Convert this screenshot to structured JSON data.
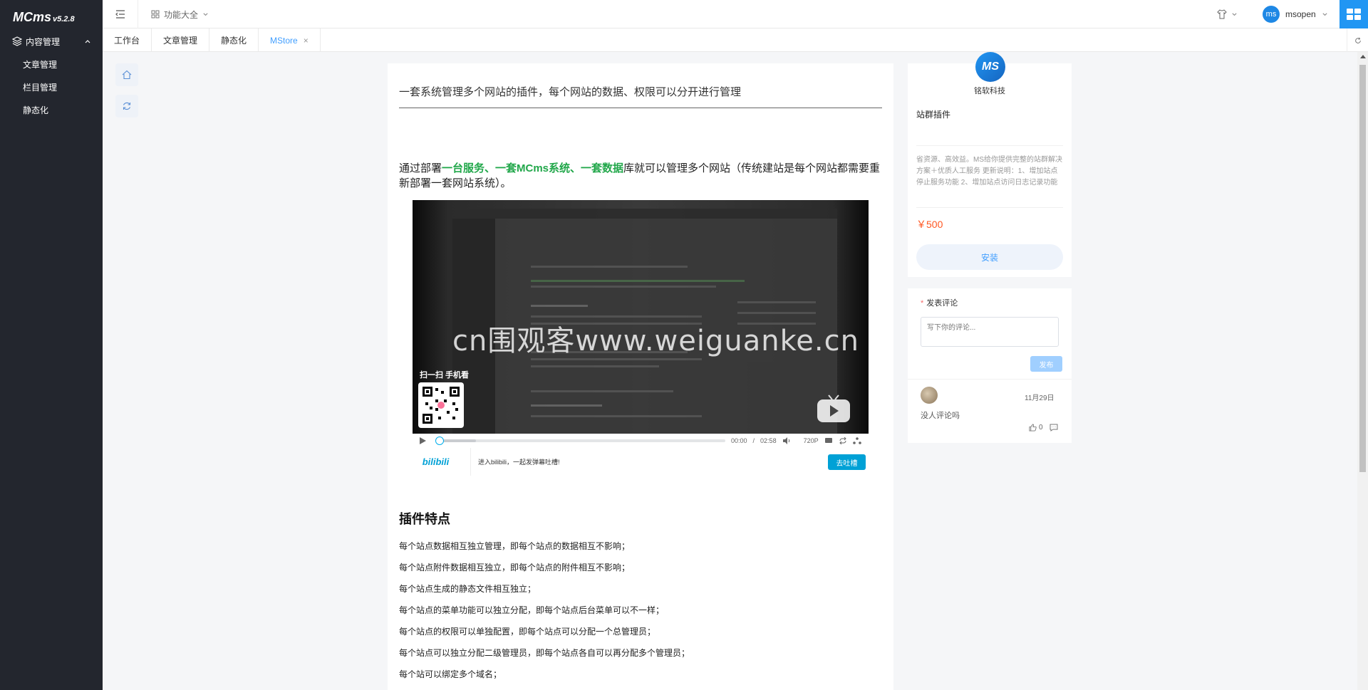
{
  "app": {
    "name": "MCms",
    "version": "v5.2.8"
  },
  "sidebar": {
    "group_label": "内容管理",
    "items": [
      {
        "label": "文章管理"
      },
      {
        "label": "栏目管理"
      },
      {
        "label": "静态化"
      }
    ]
  },
  "header": {
    "func_label": "功能大全",
    "user_avatar": "ms",
    "user_name": "msopen"
  },
  "tabs": [
    {
      "label": "工作台",
      "active": false
    },
    {
      "label": "文章管理",
      "active": false
    },
    {
      "label": "静态化",
      "active": false
    },
    {
      "label": "MStore",
      "active": true,
      "closable": true
    }
  ],
  "article": {
    "title": "一套系统管理多个网站的插件，每个网站的数据、权限可以分开进行管理",
    "intro_before": "通过部署",
    "intro_highlight": "一台服务、一套MCms系统、一套数据",
    "intro_after": "库就可以管理多个网站（传统建站是每个网站都需要重新部署一套网站系统）。",
    "video": {
      "watermark": "cn围观客www.weiguanke.cn",
      "scan_text": "扫一扫 手机看",
      "time_current": "00:00",
      "time_separator": "/",
      "time_total": "02:58",
      "quality": "720P",
      "bili_logo": "bilibili",
      "bili_prompt": "进入bilibili，一起发弹幕吐槽!",
      "bili_button": "去吐槽"
    },
    "features_title": "插件特点",
    "features": [
      "每个站点数据相互独立管理，即每个站点的数据相互不影响；",
      "每个站点附件数据相互独立，即每个站点的附件相互不影响；",
      "每个站点生成的静态文件相互独立；",
      "每个站点的菜单功能可以独立分配，即每个站点后台菜单可以不一样；",
      "每个站点的权限可以单独配置，即每个站点可以分配一个总管理员；",
      "每个站点可以独立分配二级管理员，即每个站点各自可以再分配多个管理员；",
      "每个站可以绑定多个域名；"
    ]
  },
  "plugin_card": {
    "logo_text": "MS",
    "company": "铭软科技",
    "name": "站群插件",
    "description": "省资源、高效益。MS给你提供完整的站群解决方案＋优质人工服务 更新说明：1、增加站点停止服务功能 2、增加站点访问日志记录功能",
    "price": "￥500",
    "install_label": "安装"
  },
  "comment": {
    "label": "发表评论",
    "required_mark": "*",
    "placeholder": "写下你的评论...",
    "publish_label": "发布",
    "items": [
      {
        "date": "11月29日",
        "text": "没人评论吗",
        "likes": "0"
      }
    ]
  },
  "colors": {
    "sidebar_bg": "#23262e",
    "accent": "#409eff",
    "highlight_green": "#21a74a",
    "price": "#ff5722",
    "bilibili": "#00a1d6"
  }
}
